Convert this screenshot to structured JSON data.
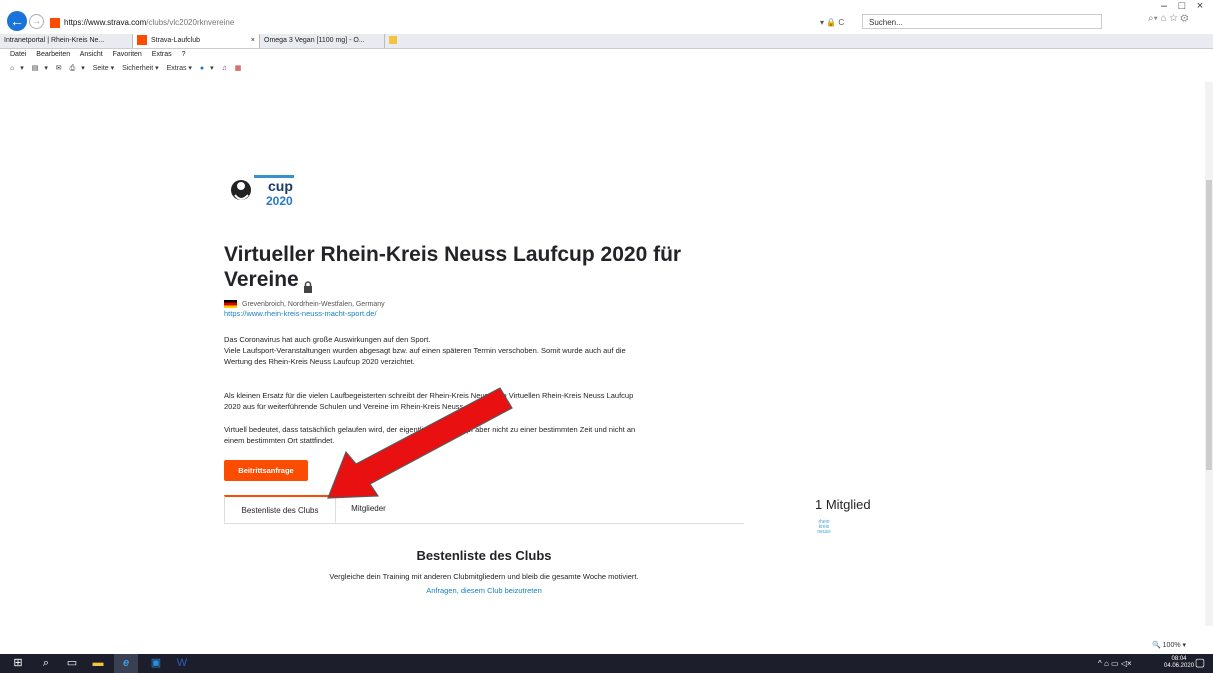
{
  "browser": {
    "url_scheme": "https://www.strava.com",
    "url_rest": "/clubs/vlc2020rknvereine",
    "addr_tools": "▾ 🔒 C",
    "search_placeholder": "Suchen...",
    "win_controls": [
      "–",
      "□",
      "×"
    ],
    "nav_icons": "⌕▾  ⌂ ☆ ⚙",
    "tabs": [
      {
        "label": "Intranetportal | Rhein-Kreis Ne..."
      },
      {
        "label": "Strava-Laufclub",
        "close": "×"
      },
      {
        "label": "Omega 3 Vegan [1100 mg] - O..."
      }
    ],
    "menu": [
      "Datei",
      "Bearbeiten",
      "Ansicht",
      "Favoriten",
      "Extras",
      "?"
    ],
    "commands": [
      "▾",
      "▾",
      "▾",
      "Seite ▾",
      "Sicherheit ▾",
      "Extras ▾",
      "▾"
    ],
    "zoom": "🔍 100%  ▾"
  },
  "club": {
    "logo_text": "cup",
    "logo_year": "2020",
    "title": "Virtueller Rhein-Kreis Neuss Laufcup 2020 für Vereine",
    "location": "Grevenbroich, Nordrhein-Westfalen, Germany",
    "website": "https://www.rhein-kreis-neuss-macht-sport.de/",
    "desc1_line1": "Das Coronavirus hat auch große Auswirkungen auf den Sport.",
    "desc1_line2": "Viele Laufsport-Veranstaltungen wurden abgesagt bzw. auf einen späteren Termin verschoben. Somit wurde auch auf die",
    "desc1_line3": "Wertung des Rhein-Kreis Neuss Laufcup 2020 verzichtet.",
    "desc2_line1": "Als kleinen Ersatz für die vielen Laufbegeisterten schreibt der Rhein-Kreis Neuss den Virtuellen Rhein-Kreis Neuss Laufcup",
    "desc2_line2": "2020 aus für weiterführende Schulen und Vereine im Rhein-Kreis Neuss.",
    "desc3_line1": "Virtuell bedeutet, dass tatsächlich gelaufen wird, der eigentliche Wettkampf aber nicht zu einer bestimmten Zeit und nicht an",
    "desc3_line2": "einem bestimmten Ort stattfindet.",
    "join_button": "Beitrittsanfrage",
    "tab_leaderboard": "Bestenliste des Clubs",
    "tab_members": "Mitglieder",
    "members_count": "1 Mitglied",
    "member_avatar_text": "rhein kreis neuss",
    "leaderboard_title": "Bestenliste des Clubs",
    "leaderboard_desc": "Vergleiche dein Training mit anderen Clubmitgliedern und bleib die gesamte Woche motiviert.",
    "leaderboard_link": "Anfragen, diesem Club beizutreten"
  },
  "taskbar": {
    "time": "08:04",
    "date": "04.06.2020",
    "tray": "^ ⌂ ▭ ◁×"
  },
  "colors": {
    "accent": "#fc4c02",
    "link": "#1a7fc2",
    "arrow": "#e81010"
  }
}
